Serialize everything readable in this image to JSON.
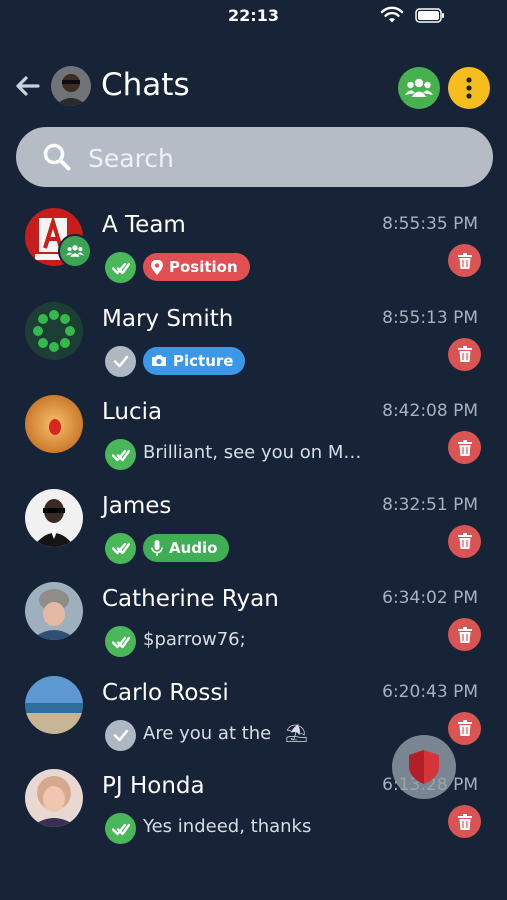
{
  "status": {
    "time": "22:13"
  },
  "header": {
    "title": "Chats"
  },
  "search": {
    "placeholder": "Search"
  },
  "chats": [
    {
      "name": "A Team",
      "time": "8:55:35 PM",
      "status": "read",
      "preview_type": "tag",
      "tag_label": "Position",
      "tag_color": "#e05053",
      "tag_icon": "location-pin-icon",
      "group": true
    },
    {
      "name": "Mary Smith",
      "time": "8:55:13 PM",
      "status": "sent",
      "preview_type": "tag",
      "tag_label": "Picture",
      "tag_color": "#3b98e8",
      "tag_icon": "camera-icon"
    },
    {
      "name": "Lucia",
      "time": "8:42:08 PM",
      "status": "read",
      "preview_type": "text",
      "preview": "Brilliant, see you on M…"
    },
    {
      "name": "James",
      "time": "8:32:51 PM",
      "status": "read",
      "preview_type": "tag",
      "tag_label": "Audio",
      "tag_color": "#40ae55",
      "tag_icon": "microphone-icon"
    },
    {
      "name": "Catherine Ryan",
      "time": "6:34:02 PM",
      "status": "read",
      "preview_type": "text",
      "preview": "$parrow76;"
    },
    {
      "name": "Carlo Rossi",
      "time": "6:20:43 PM",
      "status": "sent",
      "preview_type": "text",
      "preview": "Are you at the",
      "emoji": "⛱"
    },
    {
      "name": "PJ Honda",
      "time": "6:13:28 PM",
      "status": "read",
      "preview_type": "text",
      "preview": "Yes indeed, thanks"
    }
  ],
  "colors": {
    "background": "#172437",
    "groups_button": "#47b04f",
    "menu_button": "#f5bd1d",
    "delete_button": "#db5454",
    "read_check": "#4ab75a",
    "sent_check": "#aeb7c2"
  }
}
